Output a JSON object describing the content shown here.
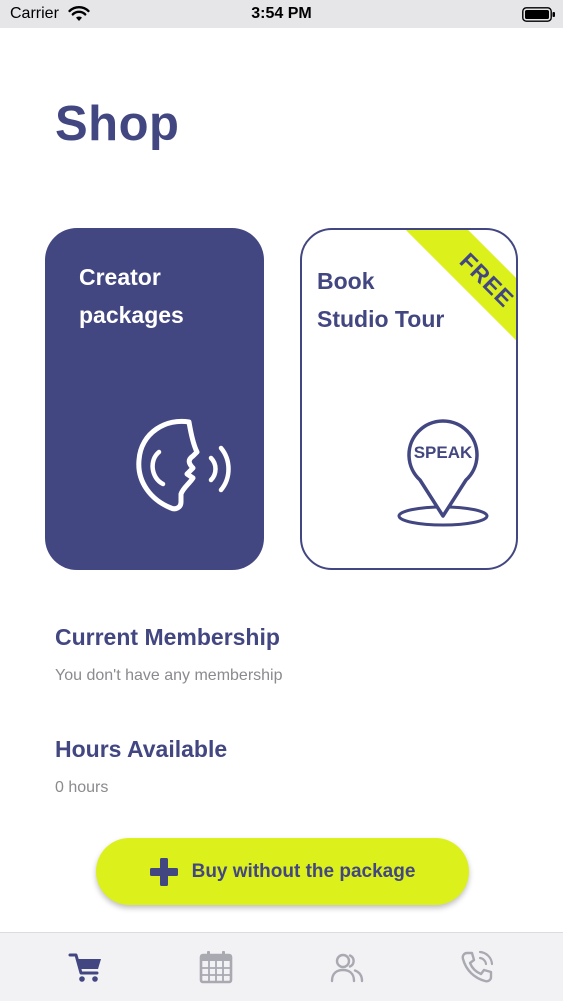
{
  "status_bar": {
    "carrier": "Carrier",
    "time": "3:54 PM"
  },
  "page": {
    "title": "Shop"
  },
  "cards": {
    "creator": {
      "title_line1": "Creator",
      "title_line2": "packages",
      "icon": "speaking-head-icon"
    },
    "tour": {
      "title_line1": "Book",
      "title_line2": "Studio Tour",
      "ribbon": "FREE",
      "pin_label": "SPEAK",
      "icon": "location-pin-icon"
    }
  },
  "membership": {
    "heading": "Current Membership",
    "value": "You don't have any membership"
  },
  "hours": {
    "heading": "Hours Available",
    "value": "0 hours"
  },
  "buy_button": {
    "label": "Buy without the package",
    "icon": "plus-icon"
  },
  "tab_bar": {
    "tabs": [
      {
        "icon": "cart-icon",
        "active": true
      },
      {
        "icon": "calendar-icon",
        "active": false
      },
      {
        "icon": "people-icon",
        "active": false
      },
      {
        "icon": "phone-icon",
        "active": false
      }
    ]
  },
  "colors": {
    "brand": "#434781",
    "accent": "#dcf01c",
    "muted_text": "#8a8a8f",
    "inactive_tab": "#a9a9b1"
  }
}
